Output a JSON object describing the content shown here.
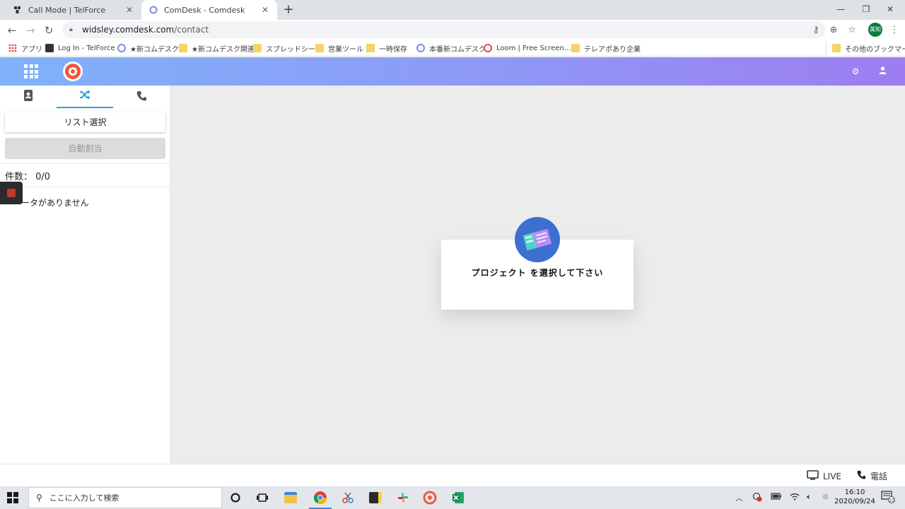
{
  "browser": {
    "tabs": [
      {
        "title": "Call Mode | TelForce",
        "icon": "telforce-favicon"
      },
      {
        "title": "ComDesk - Comdesk",
        "icon": "comdesk-favicon"
      }
    ],
    "url_host": "widsley.comdesk.com",
    "url_path": "/contact",
    "profile_label": "美知",
    "bookmarks": [
      {
        "label": "アプリ",
        "icon": "apps-grid-icon"
      },
      {
        "label": "Log In - TelForce",
        "icon": "telforce-favicon"
      },
      {
        "label": "★新コムデスク",
        "icon": "comdesk-favicon"
      },
      {
        "label": "★新コムデスク関連",
        "icon": "folder-icon"
      },
      {
        "label": "スプレッドシート",
        "icon": "folder-icon"
      },
      {
        "label": "営業ツール",
        "icon": "folder-icon"
      },
      {
        "label": "一時保存",
        "icon": "folder-icon"
      },
      {
        "label": "本番新コムデスク",
        "icon": "comdesk-favicon"
      },
      {
        "label": "Loom | Free Screen...",
        "icon": "loom-favicon"
      },
      {
        "label": "テレアポあり企業",
        "icon": "folder-icon"
      }
    ],
    "other_bookmarks": "その他のブックマーク"
  },
  "sidebar": {
    "tabs": [
      {
        "icon": "contact-book-icon",
        "active": false
      },
      {
        "icon": "shuffle-icon",
        "active": true
      },
      {
        "icon": "phone-icon",
        "active": false
      }
    ],
    "list_select_label": "リスト選択",
    "auto_assign_label": "自動割当",
    "count_label": "件数：",
    "count_value": "0/0",
    "no_data_text": "ータがありません"
  },
  "main": {
    "prompt_text": "プロジェクト を選択して下さい",
    "badge_color": "#3d6fd1"
  },
  "footer": {
    "live_label": "LIVE",
    "phone_label": "電話"
  },
  "taskbar": {
    "search_placeholder": "ここに入力して検索",
    "time": "16:10",
    "date": "2020/09/24",
    "notification_count": "12"
  },
  "colors": {
    "header_gradient_start": "#7fb2fb",
    "header_gradient_end": "#9d7df0",
    "accent": "#29a3d6",
    "logo": "#ef5a3c"
  }
}
